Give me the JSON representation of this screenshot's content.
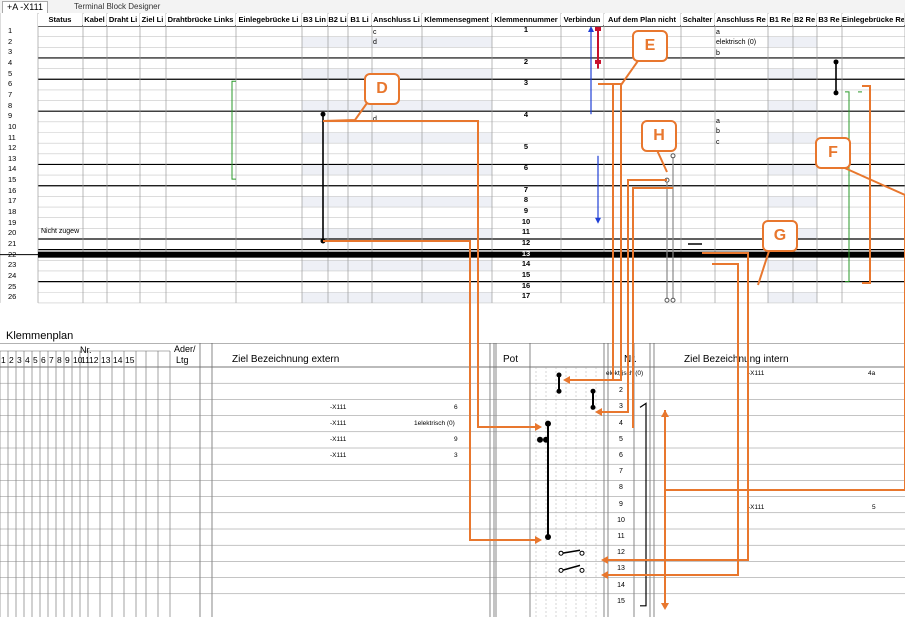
{
  "window": {
    "tab_active": "+A -X111",
    "tab_title": "Terminal Block Designer"
  },
  "grid": {
    "columns": [
      "Status",
      "Kabel",
      "Draht Li",
      "Ziel Li",
      "Drahtbrücke Links",
      "Einlegebrücke Li",
      "B3 Lin",
      "B2 Li",
      "B1 Li",
      "Anschluss Li",
      "Klemmensegment",
      "Klemmennummer",
      "Verbindun",
      "Auf dem Plan nicht",
      "Schalter",
      "Anschluss Re",
      "B1 Re",
      "B2 Re",
      "B3 Re",
      "Einlegebrücke Re"
    ],
    "rows": [
      "1",
      "2",
      "3",
      "4",
      "5",
      "6",
      "7",
      "8",
      "9",
      "10",
      "11",
      "12",
      "13",
      "14",
      "15",
      "16",
      "17",
      "18",
      "19",
      "20",
      "21",
      "22",
      "23",
      "24",
      "25",
      "26"
    ],
    "terminal_numbers": [
      "1",
      "2",
      "3",
      "4",
      "5",
      "6",
      "7",
      "8",
      "9",
      "10",
      "11",
      "12",
      "13",
      "14",
      "15",
      "16",
      "17"
    ],
    "status_row19": "Nicht zugew",
    "anschluss_left": {
      "c": "c",
      "d": "d",
      "d2": "d"
    },
    "anschluss_right": {
      "a1": "a",
      "elek": "elektrisch (0)",
      "b1": "b",
      "a2": "a",
      "b2": "b",
      "c2": "c"
    }
  },
  "callouts": [
    "D",
    "E",
    "F",
    "G",
    "H"
  ],
  "klemmenplan": {
    "title": "Klemmenplan",
    "nr_label": "Nr.",
    "nr_numbers": [
      "1",
      "2",
      "3",
      "4",
      "5",
      "6",
      "7",
      "8",
      "9",
      "10",
      "11",
      "12",
      "13",
      "14",
      "15"
    ],
    "ader_label": "Ader/",
    "ltg_label": "Ltg",
    "ziel_extern": "Ziel Bezeichnung extern",
    "pot": "Pot",
    "nr_col": "Nr.",
    "ziel_intern": "Ziel Bezeichnung intern",
    "terminal_rows": [
      "1",
      "2",
      "3",
      "4",
      "5",
      "6",
      "7",
      "8",
      "9",
      "10",
      "11",
      "12",
      "13",
      "14",
      "15"
    ],
    "extern_entries": [
      {
        "dev": "-X111",
        "val": "6"
      },
      {
        "dev": "-X111",
        "val": "1elektrisch (0)"
      },
      {
        "dev": "-X111",
        "val": "9"
      },
      {
        "dev": "-X111",
        "val": "3"
      }
    ],
    "intern_entries": [
      {
        "dev": "-X111",
        "val": "4a"
      },
      {
        "dev": "-X111",
        "val": "5"
      }
    ],
    "elektrisch_label": "elektrisch (0)"
  },
  "colors": {
    "accent": "#e8772e",
    "blue": "#1f3fd6",
    "red": "#c8102e",
    "green": "#2a9a2a"
  }
}
